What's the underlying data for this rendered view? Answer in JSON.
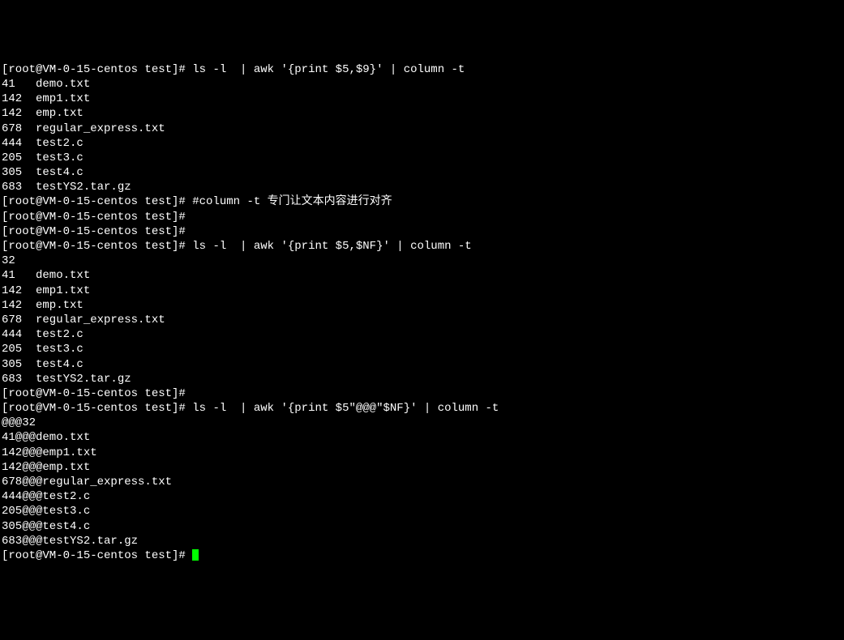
{
  "prompt": "[root@VM-0-15-centos test]# ",
  "cmd1": "ls -l  | awk '{print $5,$9}' | column -t",
  "out1": [
    "41   demo.txt",
    "142  emp1.txt",
    "142  emp.txt",
    "678  regular_express.txt",
    "444  test2.c",
    "205  test3.c",
    "305  test4.c",
    "683  testYS2.tar.gz"
  ],
  "cmd2": "#column -t 专门让文本内容进行对齐",
  "cmd3": "",
  "cmd4": "",
  "cmd5": "ls -l  | awk '{print $5,$NF}' | column -t",
  "out5first": "32",
  "out5": [
    "41   demo.txt",
    "142  emp1.txt",
    "142  emp.txt",
    "678  regular_express.txt",
    "444  test2.c",
    "205  test3.c",
    "305  test4.c",
    "683  testYS2.tar.gz"
  ],
  "cmd6": "",
  "cmd7": "ls -l  | awk '{print $5\"@@@\"$NF}' | column -t",
  "out7": [
    "@@@32",
    "41@@@demo.txt",
    "142@@@emp1.txt",
    "142@@@emp.txt",
    "678@@@regular_express.txt",
    "444@@@test2.c",
    "205@@@test3.c",
    "305@@@test4.c",
    "683@@@testYS2.tar.gz"
  ],
  "cmd8": ""
}
